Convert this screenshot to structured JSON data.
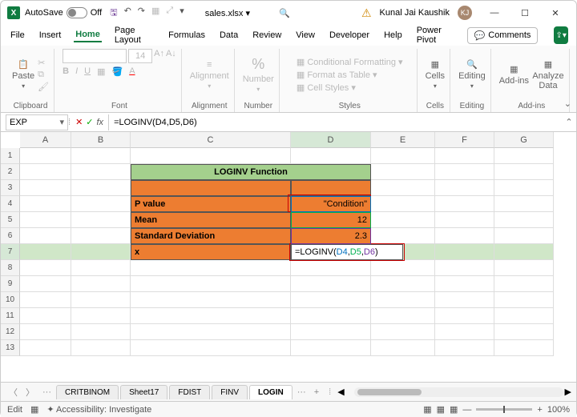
{
  "titlebar": {
    "autosave_label": "AutoSave",
    "autosave_state": "Off",
    "filename": "sales.xlsx ▾",
    "search_icon": "🔍",
    "user_name": "Kunal Jai Kaushik",
    "user_initials": "KJ"
  },
  "tabs": {
    "items": [
      "File",
      "Insert",
      "Home",
      "Page Layout",
      "Formulas",
      "Data",
      "Review",
      "View",
      "Developer",
      "Help",
      "Power Pivot"
    ],
    "active": "Home",
    "comments": "Comments"
  },
  "ribbon": {
    "clipboard": "Clipboard",
    "paste": "Paste",
    "font": "Font",
    "font_name": "",
    "font_size": "14",
    "alignment": "Alignment",
    "alignment_btn": "Alignment",
    "number": "Number",
    "number_btn": "Number",
    "styles": "Styles",
    "cf": "Conditional Formatting",
    "ft": "Format as Table",
    "cs": "Cell Styles",
    "cells": "Cells",
    "cells_btn": "Cells",
    "editing": "Editing",
    "editing_btn": "Editing",
    "addins": "Add-ins",
    "addins_btn": "Add-ins",
    "analyze": "Analyze Data"
  },
  "namebox": "EXP",
  "formula": "=LOGINV(D4,D5,D6)",
  "columns": [
    "A",
    "B",
    "C",
    "D",
    "E",
    "F",
    "G"
  ],
  "rows": [
    1,
    2,
    3,
    4,
    5,
    6,
    7,
    8,
    9,
    10,
    11,
    12,
    13
  ],
  "sheet": {
    "title": "LOGINV Function",
    "r4c": "P value",
    "r4d": "\"Condition\"",
    "r5c": "Mean",
    "r5d": "12",
    "r6c": "Standard Deviation",
    "r6d": "2.3",
    "r7c": "x",
    "r7d_prefix": "=LOGINV(",
    "r7d_a1": "D4",
    "r7d_c1": ",",
    "r7d_a2": "D5",
    "r7d_c2": ",",
    "r7d_a3": "D6",
    "r7d_sfx": ")"
  },
  "sheettabs": {
    "items": [
      "CRITBINOM",
      "Sheet17",
      "FDIST",
      "FINV",
      "LOGIN"
    ],
    "active": "LOGIN",
    "more": "···",
    "plus": "+"
  },
  "status": {
    "mode": "Edit",
    "accessibility": "Accessibility: Investigate",
    "zoom": "100%"
  },
  "chart_data": {
    "type": "table",
    "title": "LOGINV Function",
    "rows": [
      {
        "label": "P value",
        "value": "\"Condition\""
      },
      {
        "label": "Mean",
        "value": 12
      },
      {
        "label": "Standard Deviation",
        "value": 2.3
      },
      {
        "label": "x",
        "value": "=LOGINV(D4,D5,D6)"
      }
    ]
  }
}
